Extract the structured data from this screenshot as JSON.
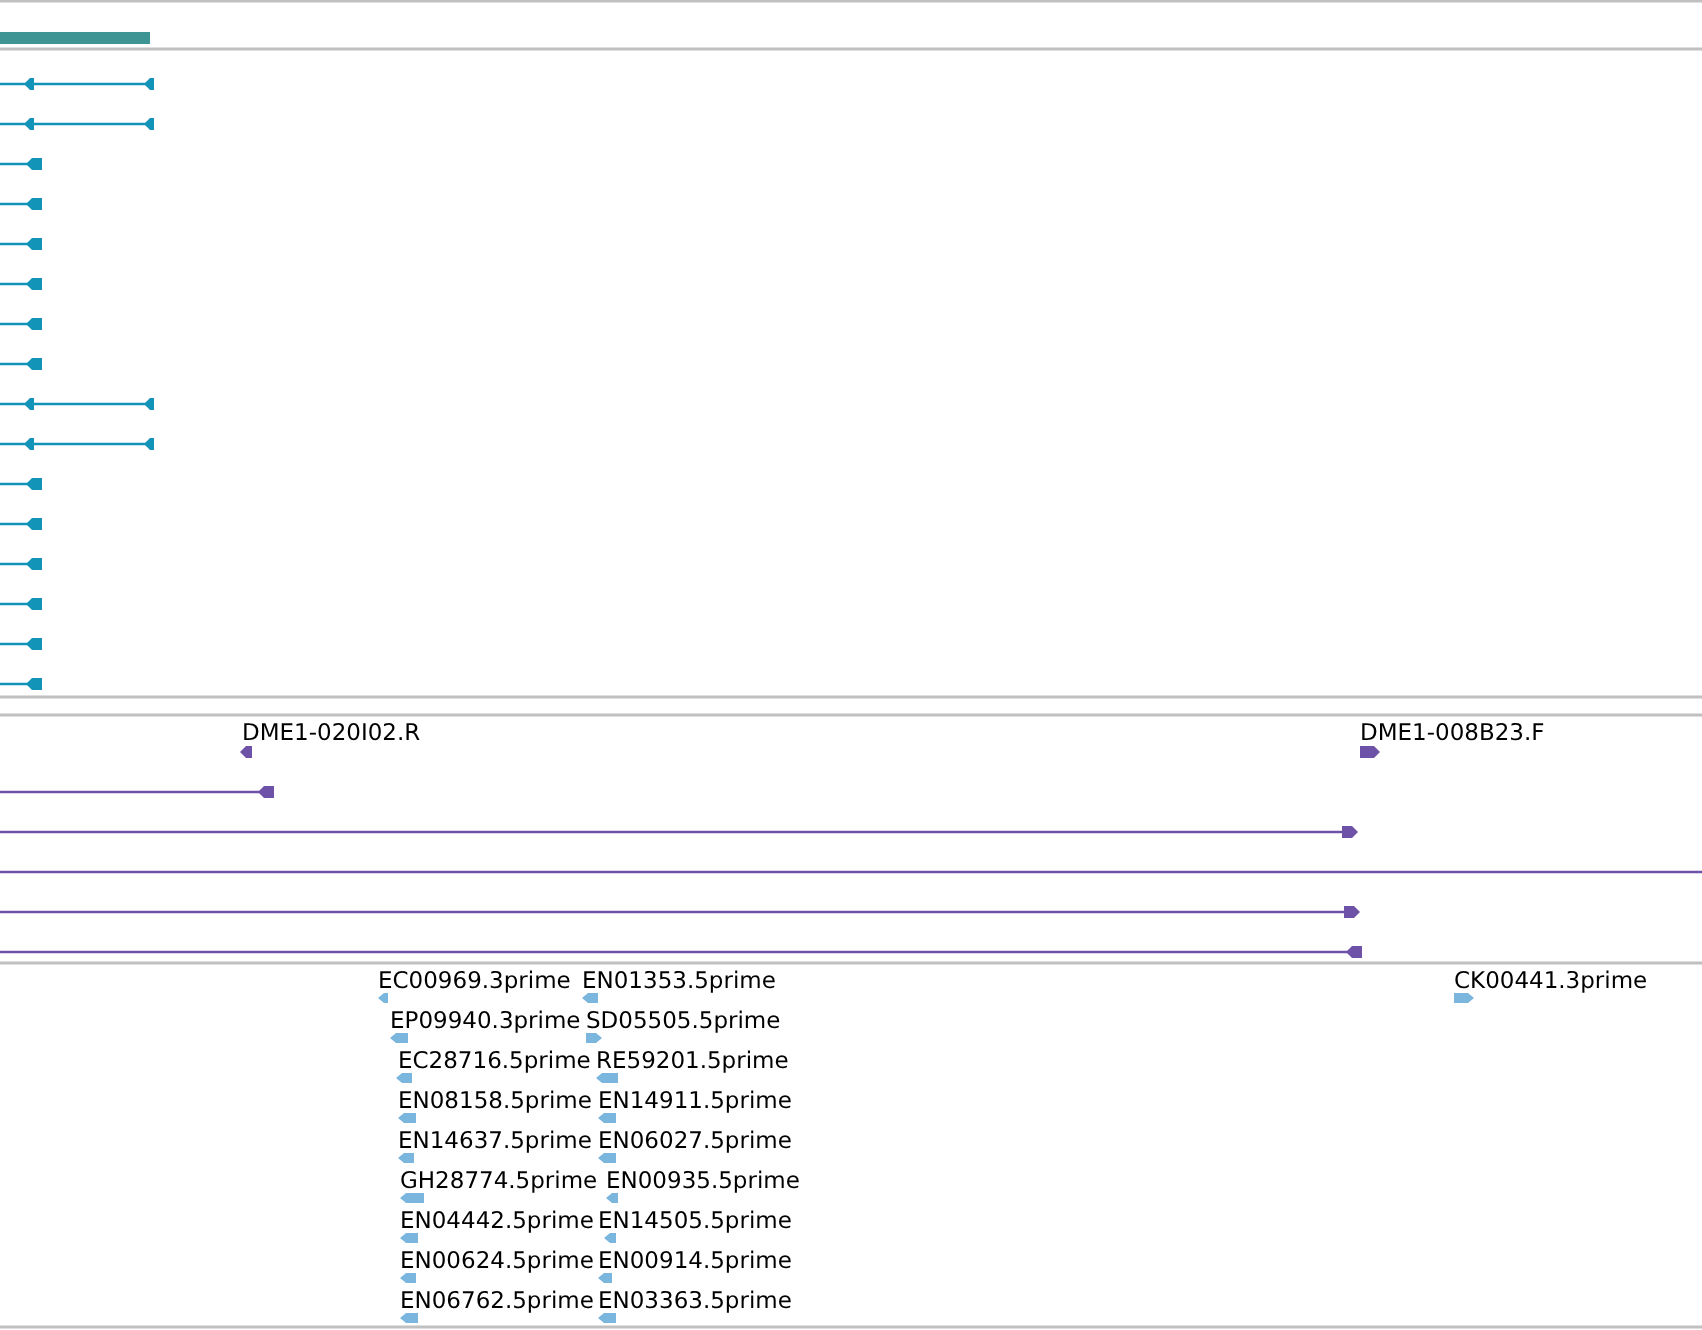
{
  "alignment_track": {
    "reads": [
      {
        "kind": "split",
        "reverse": true
      },
      {
        "kind": "split",
        "reverse": true
      },
      {
        "kind": "single",
        "reverse": true
      },
      {
        "kind": "single",
        "reverse": true
      },
      {
        "kind": "single",
        "reverse": true
      },
      {
        "kind": "single",
        "reverse": true
      },
      {
        "kind": "single",
        "reverse": true
      },
      {
        "kind": "single",
        "reverse": true
      },
      {
        "kind": "split",
        "reverse": true
      },
      {
        "kind": "split",
        "reverse": true
      },
      {
        "kind": "single",
        "reverse": true
      },
      {
        "kind": "single",
        "reverse": true
      },
      {
        "kind": "single",
        "reverse": true
      },
      {
        "kind": "single",
        "reverse": true
      },
      {
        "kind": "single",
        "reverse": true
      },
      {
        "kind": "single",
        "reverse": true
      }
    ]
  },
  "clone_end_track": {
    "features": [
      {
        "label": "DME1-020I02.R",
        "reverse": true
      },
      {
        "label": "DME1-008B23.F",
        "reverse": false
      }
    ],
    "spans": [
      {
        "kind": "arrow",
        "reverse": true
      },
      {
        "kind": "arrow",
        "reverse": false
      },
      {
        "kind": "line"
      },
      {
        "kind": "arrow",
        "reverse": false
      },
      {
        "kind": "arrow",
        "reverse": true
      }
    ]
  },
  "est_track": {
    "columns": [
      [
        {
          "label": "EC00969.3prime",
          "reverse": true
        },
        {
          "label": "EP09940.3prime",
          "reverse": true
        },
        {
          "label": "EC28716.5prime",
          "reverse": true
        },
        {
          "label": "EN08158.5prime",
          "reverse": true
        },
        {
          "label": "EN14637.5prime",
          "reverse": true
        },
        {
          "label": "GH28774.5prime",
          "reverse": true
        },
        {
          "label": "EN04442.5prime",
          "reverse": true
        },
        {
          "label": "EN00624.5prime",
          "reverse": true
        },
        {
          "label": "EN06762.5prime",
          "reverse": true
        }
      ],
      [
        {
          "label": "EN01353.5prime",
          "reverse": true
        },
        {
          "label": "SD05505.5prime",
          "reverse": false
        },
        {
          "label": "RE59201.5prime",
          "reverse": true
        },
        {
          "label": "EN14911.5prime",
          "reverse": true
        },
        {
          "label": "EN06027.5prime",
          "reverse": true
        },
        {
          "label": "EN00935.5prime",
          "reverse": true
        },
        {
          "label": "EN14505.5prime",
          "reverse": true
        },
        {
          "label": "EN00914.5prime",
          "reverse": true
        },
        {
          "label": "EN03363.5prime",
          "reverse": true
        }
      ],
      [
        {
          "label": "CK00441.3prime",
          "reverse": false
        }
      ]
    ]
  }
}
